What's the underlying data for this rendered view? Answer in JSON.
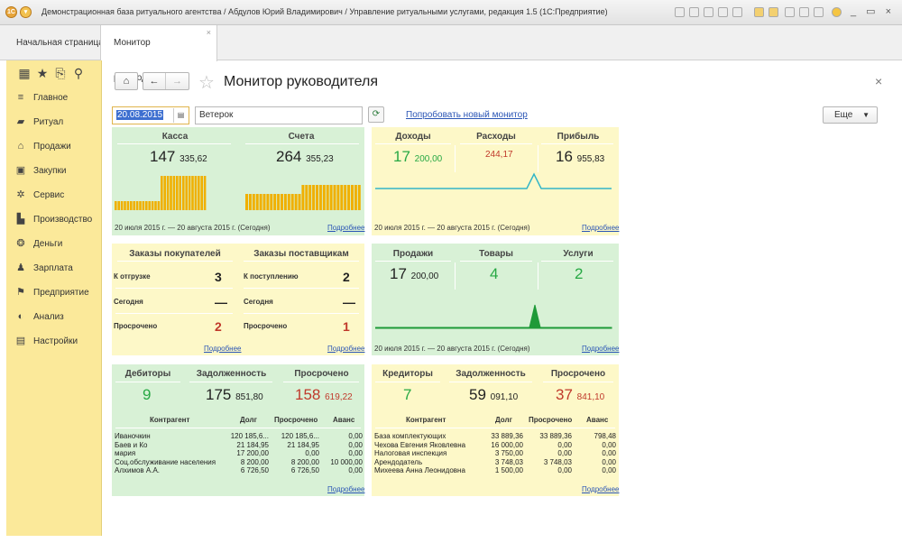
{
  "window": {
    "title": "Демонстрационная база ритуального агентства / Абдулов Юрий Владимирович / Управление ритуальными услугами, редакция 1.5  (1С:Предприятие)",
    "controls": "_ ▭ ×"
  },
  "tabs": [
    {
      "label": "Начальная страница"
    },
    {
      "label": "Монитор руководителя",
      "close": "×"
    }
  ],
  "sidebar": {
    "items": [
      {
        "label": "Главное",
        "icon": "menu-icon"
      },
      {
        "label": "Ритуал",
        "icon": "ritual-icon"
      },
      {
        "label": "Продажи",
        "icon": "sales-icon"
      },
      {
        "label": "Закупки",
        "icon": "purchases-icon"
      },
      {
        "label": "Сервис",
        "icon": "service-icon"
      },
      {
        "label": "Производство",
        "icon": "production-icon"
      },
      {
        "label": "Деньги",
        "icon": "money-icon"
      },
      {
        "label": "Зарплата",
        "icon": "salary-icon"
      },
      {
        "label": "Предприятие",
        "icon": "enterprise-icon"
      },
      {
        "label": "Анализ",
        "icon": "analysis-icon"
      },
      {
        "label": "Настройки",
        "icon": "settings-icon"
      }
    ]
  },
  "header": {
    "title": "Монитор руководителя",
    "date": "20.08.2015",
    "organization": "Ветерок",
    "try_new_link": "Попробовать новый монитор",
    "more_button": "Еще"
  },
  "period_text": "20 июля 2015 г. — 20 августа 2015 г. (Сегодня)",
  "details_link": "Подробнее",
  "cash": {
    "kassa_label": "Касса",
    "kassa_int": "147",
    "kassa_frac": "335,62",
    "accounts_label": "Счета",
    "accounts_int": "264",
    "accounts_frac": "355,23"
  },
  "pnl": {
    "income_label": "Доходы",
    "income_int": "17",
    "income_frac": "200,00",
    "expense_label": "Расходы",
    "expense_value": "244,17",
    "profit_label": "Прибыль",
    "profit_int": "16",
    "profit_frac": "955,83"
  },
  "orders": {
    "customers_label": "Заказы покупателей",
    "suppliers_label": "Заказы поставщикам",
    "rows": [
      {
        "c_label": "К отгрузке",
        "c_value": "3",
        "s_label": "К поступлению",
        "s_value": "2"
      },
      {
        "c_label": "Сегодня",
        "c_value": "—",
        "s_label": "Сегодня",
        "s_value": "—"
      },
      {
        "c_label": "Просрочено",
        "c_value": "2",
        "s_label": "Просрочено",
        "s_value": "1"
      }
    ]
  },
  "sales": {
    "sales_label": "Продажи",
    "sales_int": "17",
    "sales_frac": "200,00",
    "goods_label": "Товары",
    "goods_value": "4",
    "services_label": "Услуги",
    "services_value": "2"
  },
  "debtors": {
    "count_label": "Дебиторы",
    "count": "9",
    "debt_label": "Задолженность",
    "debt_int": "175",
    "debt_frac": "851,80",
    "overdue_label": "Просрочено",
    "overdue_int": "158",
    "overdue_frac": "619,22",
    "columns": [
      "Контрагент",
      "Долг",
      "Просрочено",
      "Аванс"
    ],
    "rows": [
      [
        "Иваночкин",
        "120 185,6...",
        "120 185,6...",
        "0,00"
      ],
      [
        "Баев и Ко",
        "21 184,95",
        "21 184,95",
        "0,00"
      ],
      [
        "мария",
        "17 200,00",
        "0,00",
        "0,00"
      ],
      [
        "Соц.обслуживание населения",
        "8 200,00",
        "8 200,00",
        "10 000,00"
      ],
      [
        "Алхимов А.А.",
        "6 726,50",
        "6 726,50",
        "0,00"
      ]
    ]
  },
  "creditors": {
    "count_label": "Кредиторы",
    "count": "7",
    "debt_label": "Задолженность",
    "debt_int": "59",
    "debt_frac": "091,10",
    "overdue_label": "Просрочено",
    "overdue_int": "37",
    "overdue_frac": "841,10",
    "columns": [
      "Контрагент",
      "Долг",
      "Просрочено",
      "Аванс"
    ],
    "rows": [
      [
        "База комплектующих",
        "33 889,36",
        "33 889,36",
        "798,48"
      ],
      [
        "Чехова Евгения Яковлевна",
        "16 000,00",
        "0,00",
        "0,00"
      ],
      [
        "Налоговая инспекция",
        "3 750,00",
        "0,00",
        "0,00"
      ],
      [
        "Арендодатель",
        "3 748,03",
        "3 748,03",
        "0,00"
      ],
      [
        "Михеева Анна Леонидовна",
        "1 500,00",
        "0,00",
        "0,00"
      ]
    ]
  },
  "colors": {
    "panel_green": "#d8f1d6",
    "panel_yellow": "#fdf8c8",
    "bar": "#f0b000",
    "line": "#33b5c7",
    "sales_peak": "#1e9a38"
  }
}
